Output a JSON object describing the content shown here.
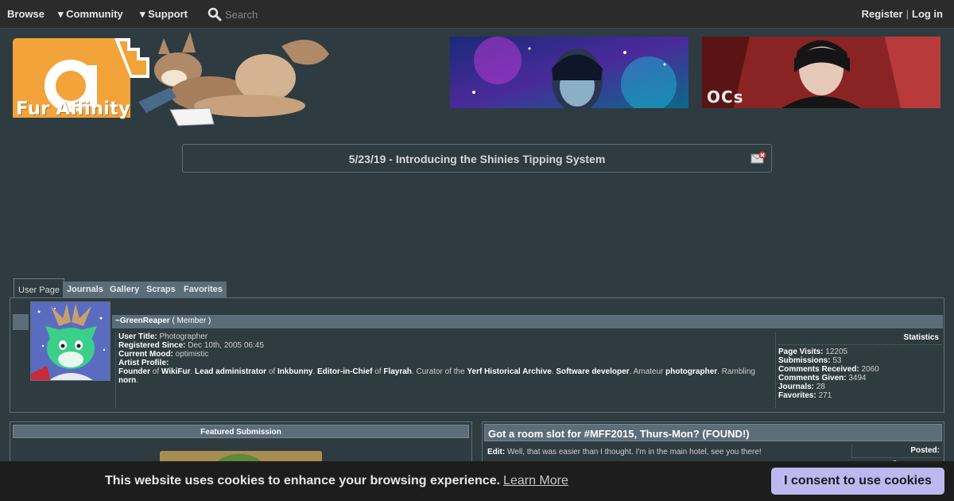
{
  "nav": {
    "browse": "Browse",
    "community": "▾ Community",
    "support": "▾ Support",
    "search_placeholder": "Search",
    "register": "Register",
    "separator": "|",
    "login": "Log in"
  },
  "logo": {
    "text": "Fur Affinity"
  },
  "banners": [
    {
      "caption": ""
    },
    {
      "caption": "OCs"
    }
  ],
  "notice": {
    "text": "5/23/19 - Introducing the Shinies Tipping System"
  },
  "tabs": [
    "User Page",
    "Journals",
    "Gallery",
    "Scraps",
    "Favorites"
  ],
  "user": {
    "name": "~GreenReaper",
    "role": "( Member )",
    "title_label": "User Title:",
    "title": "Photographer",
    "registered_label": "Registered Since:",
    "registered": "Dec 10th, 2005 06:45",
    "mood_label": "Current Mood:",
    "mood": "optimistic",
    "profile_label": "Artist Profile:",
    "profile": {
      "p1": "Founder",
      "p2": " of ",
      "p3": "WikiFur",
      "p4": ". ",
      "p5": "Lead administrator",
      "p6": " of ",
      "p7": "Inkbunny",
      "p8": ". ",
      "p9": "Editor-in-Chief",
      "p10": " of ",
      "p11": "Flayrah",
      "p12": ". Curator of the ",
      "p13": "Yerf Historical Archive",
      "p14": ". ",
      "p15": "Software developer",
      "p16": ". Amateur ",
      "p17": "photographer",
      "p18": ". Rambling ",
      "p19": "norn",
      "p20": "."
    }
  },
  "stats": {
    "header": "Statistics",
    "rows": [
      {
        "label": "Page Visits:",
        "value": "12205"
      },
      {
        "label": "Submissions:",
        "value": "53"
      },
      {
        "label": "Comments Received:",
        "value": "2060"
      },
      {
        "label": "Comments Given:",
        "value": "3494"
      },
      {
        "label": "Journals:",
        "value": "28"
      },
      {
        "label": "Favorites:",
        "value": "271"
      }
    ]
  },
  "featured": {
    "header": "Featured Submission"
  },
  "journal": {
    "title": "Got a room slot for #MFF2015, Thurs-Mon? (FOUND!)",
    "edit_label": "Edit:",
    "body": "Well, that was easier than I thought. I'm in the main hotel, see you there!",
    "posted_label": "Posted:",
    "posted": "3 years ago"
  },
  "cookie": {
    "message": "This website uses cookies to enhance your browsing experience.",
    "learn_more": "Learn More",
    "consent": "I consent to use cookies"
  },
  "colors": {
    "bg": "#2e3b41",
    "panel_header": "#5b6d78",
    "logo_orange": "#f2a33a",
    "cookie_button": "#bfb8f0"
  }
}
